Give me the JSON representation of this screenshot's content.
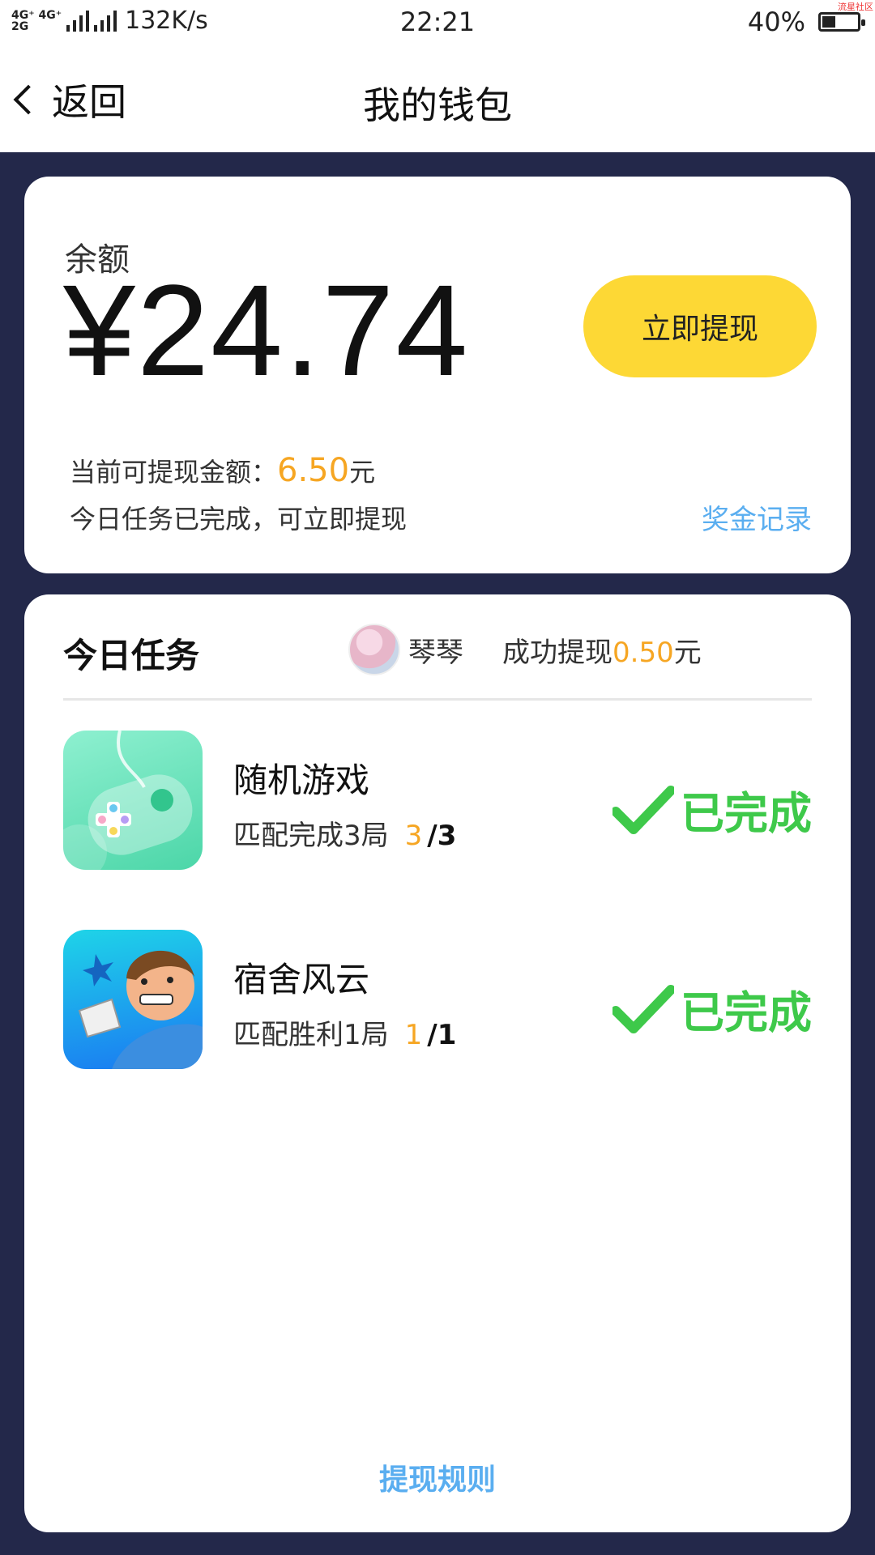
{
  "status_bar": {
    "network_top": "4G⁺ 4G⁺",
    "network_bottom": "2G",
    "speed": "132K/s",
    "time": "22:21",
    "battery": "40%",
    "watermark": "流星社区"
  },
  "nav": {
    "back_label": "返回",
    "title": "我的钱包"
  },
  "balance_card": {
    "label": "余额",
    "amount": "¥24.74",
    "withdraw_button": "立即提现",
    "available_prefix": "当前可提现金额：",
    "available_amount": "6.50",
    "available_unit": "元",
    "task_status_text": "今日任务已完成，可立即提现",
    "records_link": "奖金记录"
  },
  "tasks_card": {
    "heading": "今日任务",
    "user_name": "琴琴",
    "success_prefix": "成功提现",
    "success_amount": "0.50",
    "success_unit": "元",
    "tasks": [
      {
        "title": "随机游戏",
        "desc": "匹配完成3局",
        "current": "3",
        "total": "/3",
        "status": "已完成",
        "icon": "game-controller-icon"
      },
      {
        "title": "宿舍风云",
        "desc": "匹配胜利1局",
        "current": "1",
        "total": "/1",
        "status": "已完成",
        "icon": "dorm-game-icon"
      }
    ],
    "rules_link": "提现规则"
  },
  "colors": {
    "accent_yellow": "#fdd835",
    "amount_orange": "#f6a623",
    "link_blue": "#5aaef0",
    "done_green": "#3ec94a",
    "background": "#23284a"
  }
}
